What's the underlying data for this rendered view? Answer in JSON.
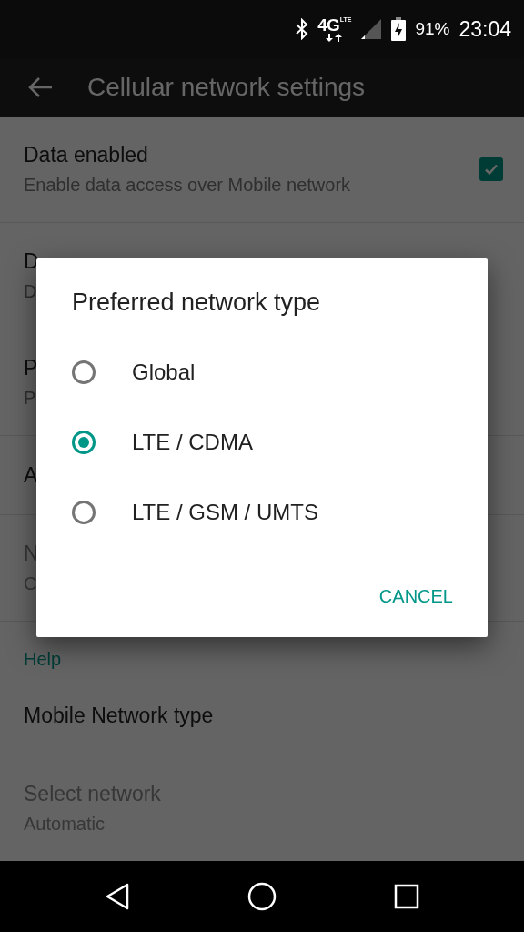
{
  "status_bar": {
    "network": "4G",
    "network_sub": "LTE",
    "battery": "91%",
    "time": "23:04"
  },
  "app_bar": {
    "title": "Cellular network settings"
  },
  "settings": [
    {
      "kind": "checkbox",
      "title": "Data enabled",
      "subtitle": "Enable data access over Mobile network",
      "checked": true,
      "disabled": false
    },
    {
      "kind": "text",
      "title": "D",
      "subtitle": "D",
      "disabled": false
    },
    {
      "kind": "text",
      "title": "P",
      "subtitle": "P",
      "disabled": false
    },
    {
      "kind": "text",
      "title": "A",
      "disabled": false
    },
    {
      "kind": "text",
      "title": "N",
      "subtitle": "C",
      "disabled": true
    },
    {
      "kind": "header",
      "title": "Help"
    },
    {
      "kind": "text",
      "title": "Mobile Network type",
      "disabled": false
    },
    {
      "kind": "text",
      "title": "Select network",
      "subtitle": "Automatic",
      "disabled": true
    }
  ],
  "dialog": {
    "title": "Preferred network type",
    "options": [
      {
        "label": "Global",
        "selected": false
      },
      {
        "label": "LTE / CDMA",
        "selected": true
      },
      {
        "label": "LTE / GSM / UMTS",
        "selected": false
      }
    ],
    "button": "CANCEL"
  }
}
